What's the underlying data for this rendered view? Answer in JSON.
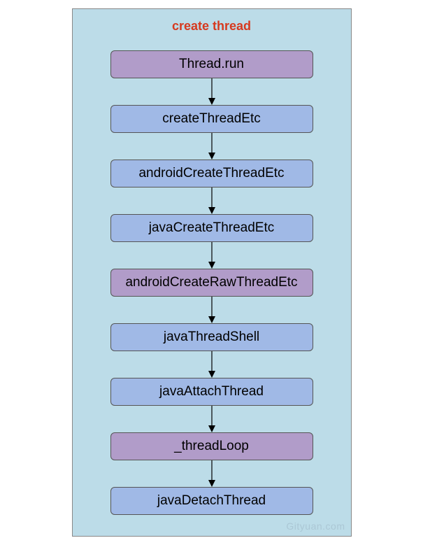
{
  "chart_data": {
    "type": "flowchart",
    "title": "create thread",
    "nodes": [
      {
        "id": "n1",
        "label": "Thread.run",
        "color": "purple"
      },
      {
        "id": "n2",
        "label": "createThreadEtc",
        "color": "blue"
      },
      {
        "id": "n3",
        "label": "androidCreateThreadEtc",
        "color": "blue"
      },
      {
        "id": "n4",
        "label": "javaCreateThreadEtc",
        "color": "blue"
      },
      {
        "id": "n5",
        "label": "androidCreateRawThreadEtc",
        "color": "purple"
      },
      {
        "id": "n6",
        "label": "javaThreadShell",
        "color": "blue"
      },
      {
        "id": "n7",
        "label": "javaAttachThread",
        "color": "blue"
      },
      {
        "id": "n8",
        "label": "_threadLoop",
        "color": "purple"
      },
      {
        "id": "n9",
        "label": "javaDetachThread",
        "color": "blue"
      }
    ],
    "edges": [
      {
        "from": "n1",
        "to": "n2"
      },
      {
        "from": "n2",
        "to": "n3"
      },
      {
        "from": "n3",
        "to": "n4"
      },
      {
        "from": "n4",
        "to": "n5"
      },
      {
        "from": "n5",
        "to": "n6"
      },
      {
        "from": "n6",
        "to": "n7"
      },
      {
        "from": "n7",
        "to": "n8"
      },
      {
        "from": "n8",
        "to": "n9"
      }
    ],
    "colors": {
      "blue": "#a0b9e6",
      "purple": "#b19cc9",
      "background": "#bcdce8",
      "title": "#d63a1f"
    }
  },
  "watermark": "Gityuan.com"
}
